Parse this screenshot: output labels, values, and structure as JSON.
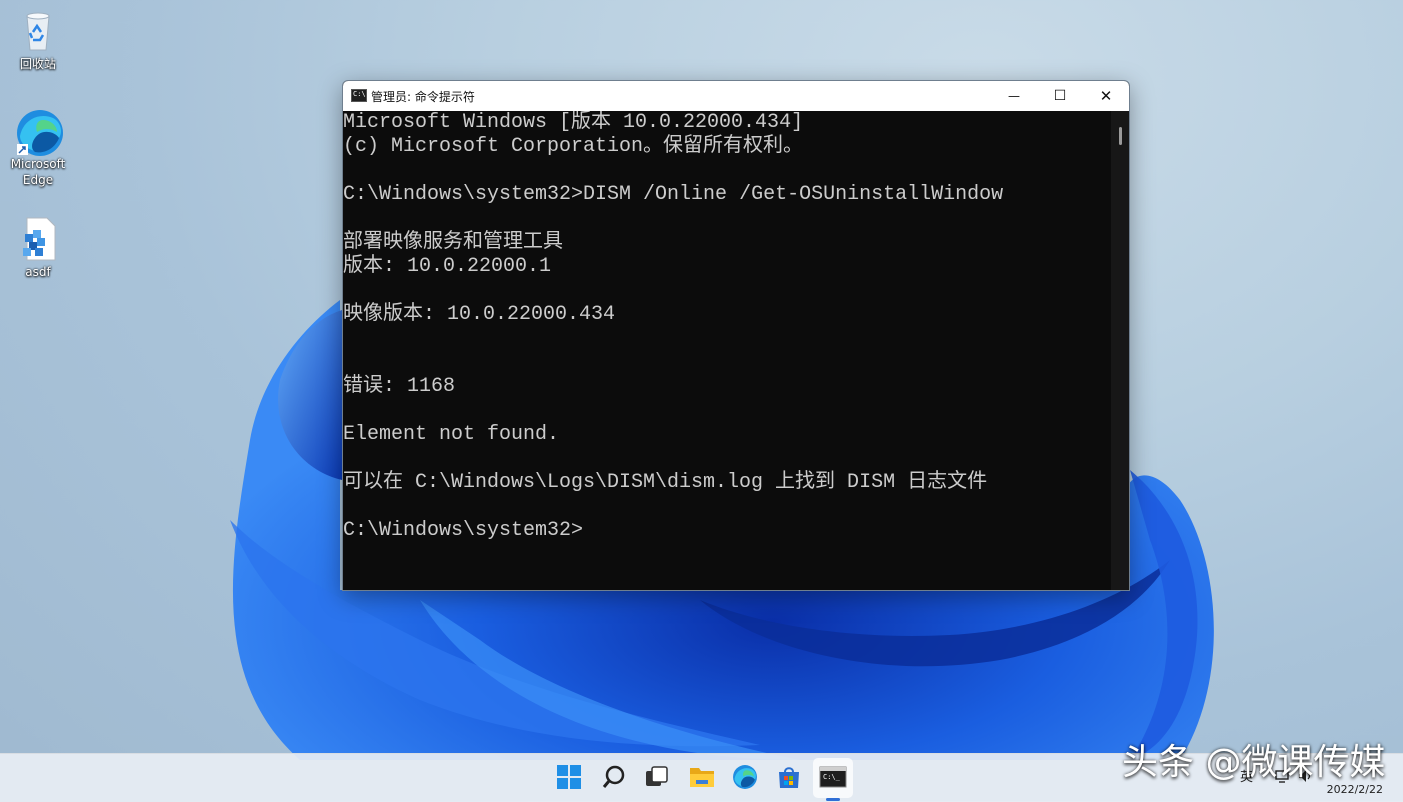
{
  "desktop": {
    "icons": [
      {
        "label": "回收站"
      },
      {
        "label": "Microsoft Edge"
      },
      {
        "label": "asdf"
      }
    ]
  },
  "window": {
    "title": "管理员: 命令提示符",
    "buttons": {
      "minimize": "—",
      "maximize": "☐",
      "close": "✕"
    },
    "console_lines": [
      "Microsoft Windows [版本 10.0.22000.434]",
      "(c) Microsoft Corporation。保留所有权利。",
      "",
      "C:\\Windows\\system32>DISM /Online /Get-OSUninstallWindow",
      "",
      "部署映像服务和管理工具",
      "版本: 10.0.22000.1",
      "",
      "映像版本: 10.0.22000.434",
      "",
      "",
      "错误: 1168",
      "",
      "Element not found.",
      "",
      "可以在 C:\\Windows\\Logs\\DISM\\dism.log 上找到 DISM 日志文件",
      "",
      "C:\\Windows\\system32>"
    ]
  },
  "taskbar": {
    "icons": [
      "windows-start-icon",
      "search-icon",
      "task-view-icon",
      "file-explorer-icon",
      "edge-icon",
      "store-icon",
      "terminal-icon"
    ],
    "tray": {
      "language": "英",
      "date": "2022/2/22"
    },
    "accent_color": "#2f6fd6"
  },
  "watermark": "头条 @微课传媒"
}
